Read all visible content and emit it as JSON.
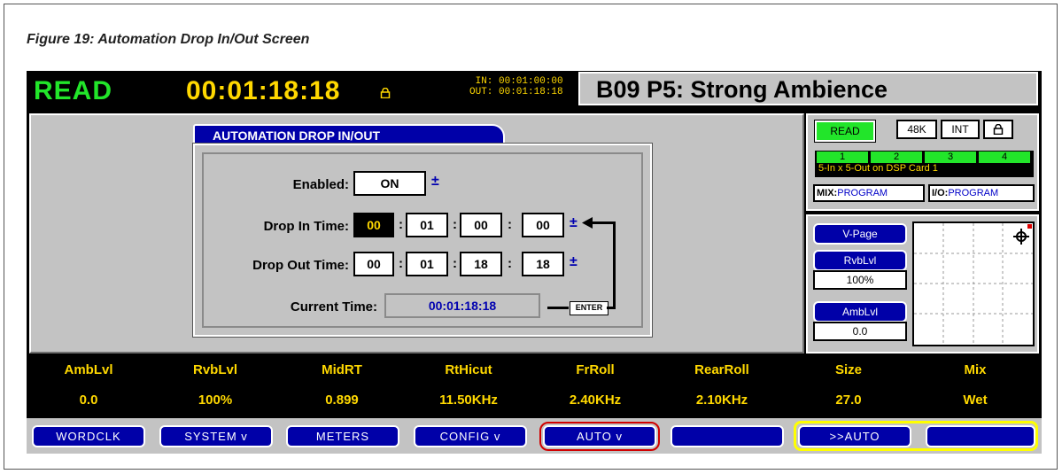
{
  "caption": "Figure 19: Automation Drop In/Out Screen",
  "topbar": {
    "mode": "READ",
    "timecode": "00:01:18:18",
    "in_time": "IN: 00:01:00:00",
    "out_time": "OUT: 00:01:18:18",
    "program": "B09 P5: Strong Ambience"
  },
  "dialog": {
    "title": "AUTOMATION DROP IN/OUT",
    "enabled_label": "Enabled:",
    "enabled_value": "ON",
    "plusminus": "±",
    "drop_in_label": "Drop In Time:",
    "drop_in": [
      "00",
      "01",
      "00",
      "00"
    ],
    "drop_out_label": "Drop Out Time:",
    "drop_out": [
      "00",
      "01",
      "18",
      "18"
    ],
    "current_label": "Current Time:",
    "current_value": "00:01:18:18",
    "enter": "ENTER",
    "colon": ":"
  },
  "status": {
    "read": "READ",
    "rate": "48K",
    "sync": "INT",
    "dsp_numbers": [
      "1",
      "2",
      "3",
      "4"
    ],
    "dsp_text": "5-In x 5-Out on DSP Card 1",
    "mix_label": "MIX:",
    "mix_value": "PROGRAM",
    "io_label": "I/O:",
    "io_value": "PROGRAM"
  },
  "vpage": {
    "button": "V-Page",
    "p1_label": "RvbLvl",
    "p1_value": "100%",
    "p2_label": "AmbLvl",
    "p2_value": "0.0"
  },
  "params": [
    {
      "name": "AmbLvl",
      "value": "0.0"
    },
    {
      "name": "RvbLvl",
      "value": "100%"
    },
    {
      "name": "MidRT",
      "value": "0.899"
    },
    {
      "name": "RtHicut",
      "value": "11.50KHz"
    },
    {
      "name": "FrRoll",
      "value": "2.40KHz"
    },
    {
      "name": "RearRoll",
      "value": "2.10KHz"
    },
    {
      "name": "Size",
      "value": "27.0"
    },
    {
      "name": "Mix",
      "value": "Wet"
    }
  ],
  "softkeys": [
    "WORDCLK",
    "SYSTEM v",
    "METERS",
    "CONFIG v",
    "AUTO v",
    "",
    ">>AUTO",
    ""
  ],
  "colors": {
    "green": "#22e52a",
    "yellow": "#ffd800",
    "blue": "#0000a8",
    "panel": "#c3c3c3",
    "highlight": "#d00000"
  }
}
